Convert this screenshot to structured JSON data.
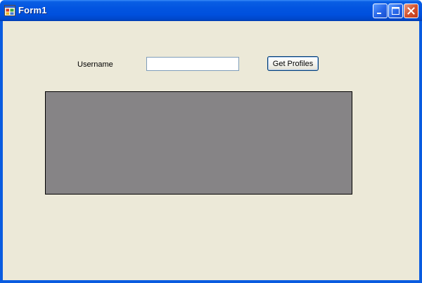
{
  "window": {
    "title": "Form1",
    "icon": "form-app-icon",
    "controls": {
      "minimize_icon": "minimize-icon",
      "maximize_icon": "maximize-icon",
      "close_icon": "close-icon"
    }
  },
  "form": {
    "username_label": "Username",
    "username_value": "",
    "username_placeholder": "",
    "get_profiles_label": "Get Profiles"
  },
  "colors": {
    "titlebar": "#0054e3",
    "client_background": "#ece9d8",
    "grid_background": "#868486",
    "close_button": "#d4532f"
  }
}
